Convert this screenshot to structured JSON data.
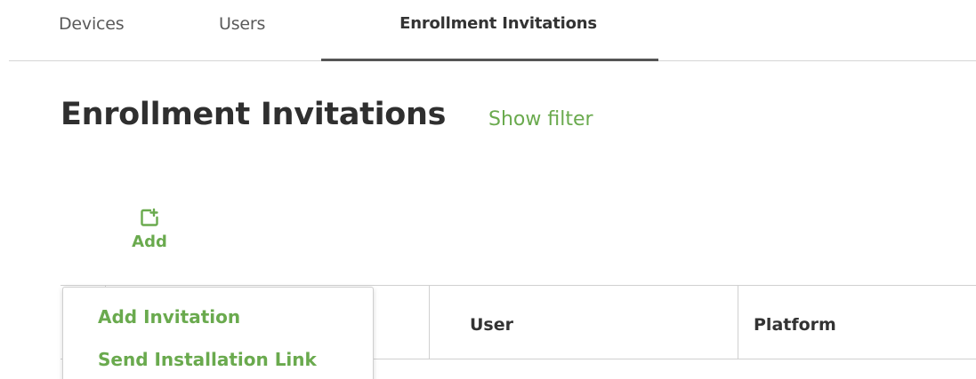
{
  "tabs": [
    {
      "label": "Devices"
    },
    {
      "label": "Users"
    },
    {
      "label": "Enrollment Invitations",
      "active": true
    }
  ],
  "page": {
    "title": "Enrollment Invitations",
    "show_filter": "Show filter"
  },
  "toolbar": {
    "add_label": "Add",
    "add_icon": "add-item-icon"
  },
  "table": {
    "columns": [
      "",
      "",
      "User",
      "Platform"
    ]
  },
  "add_menu": {
    "items": [
      "Add Invitation",
      "Send Installation Link"
    ]
  },
  "colors": {
    "accent_green": "#6aaa4e",
    "active_tab_underline": "#555555"
  }
}
